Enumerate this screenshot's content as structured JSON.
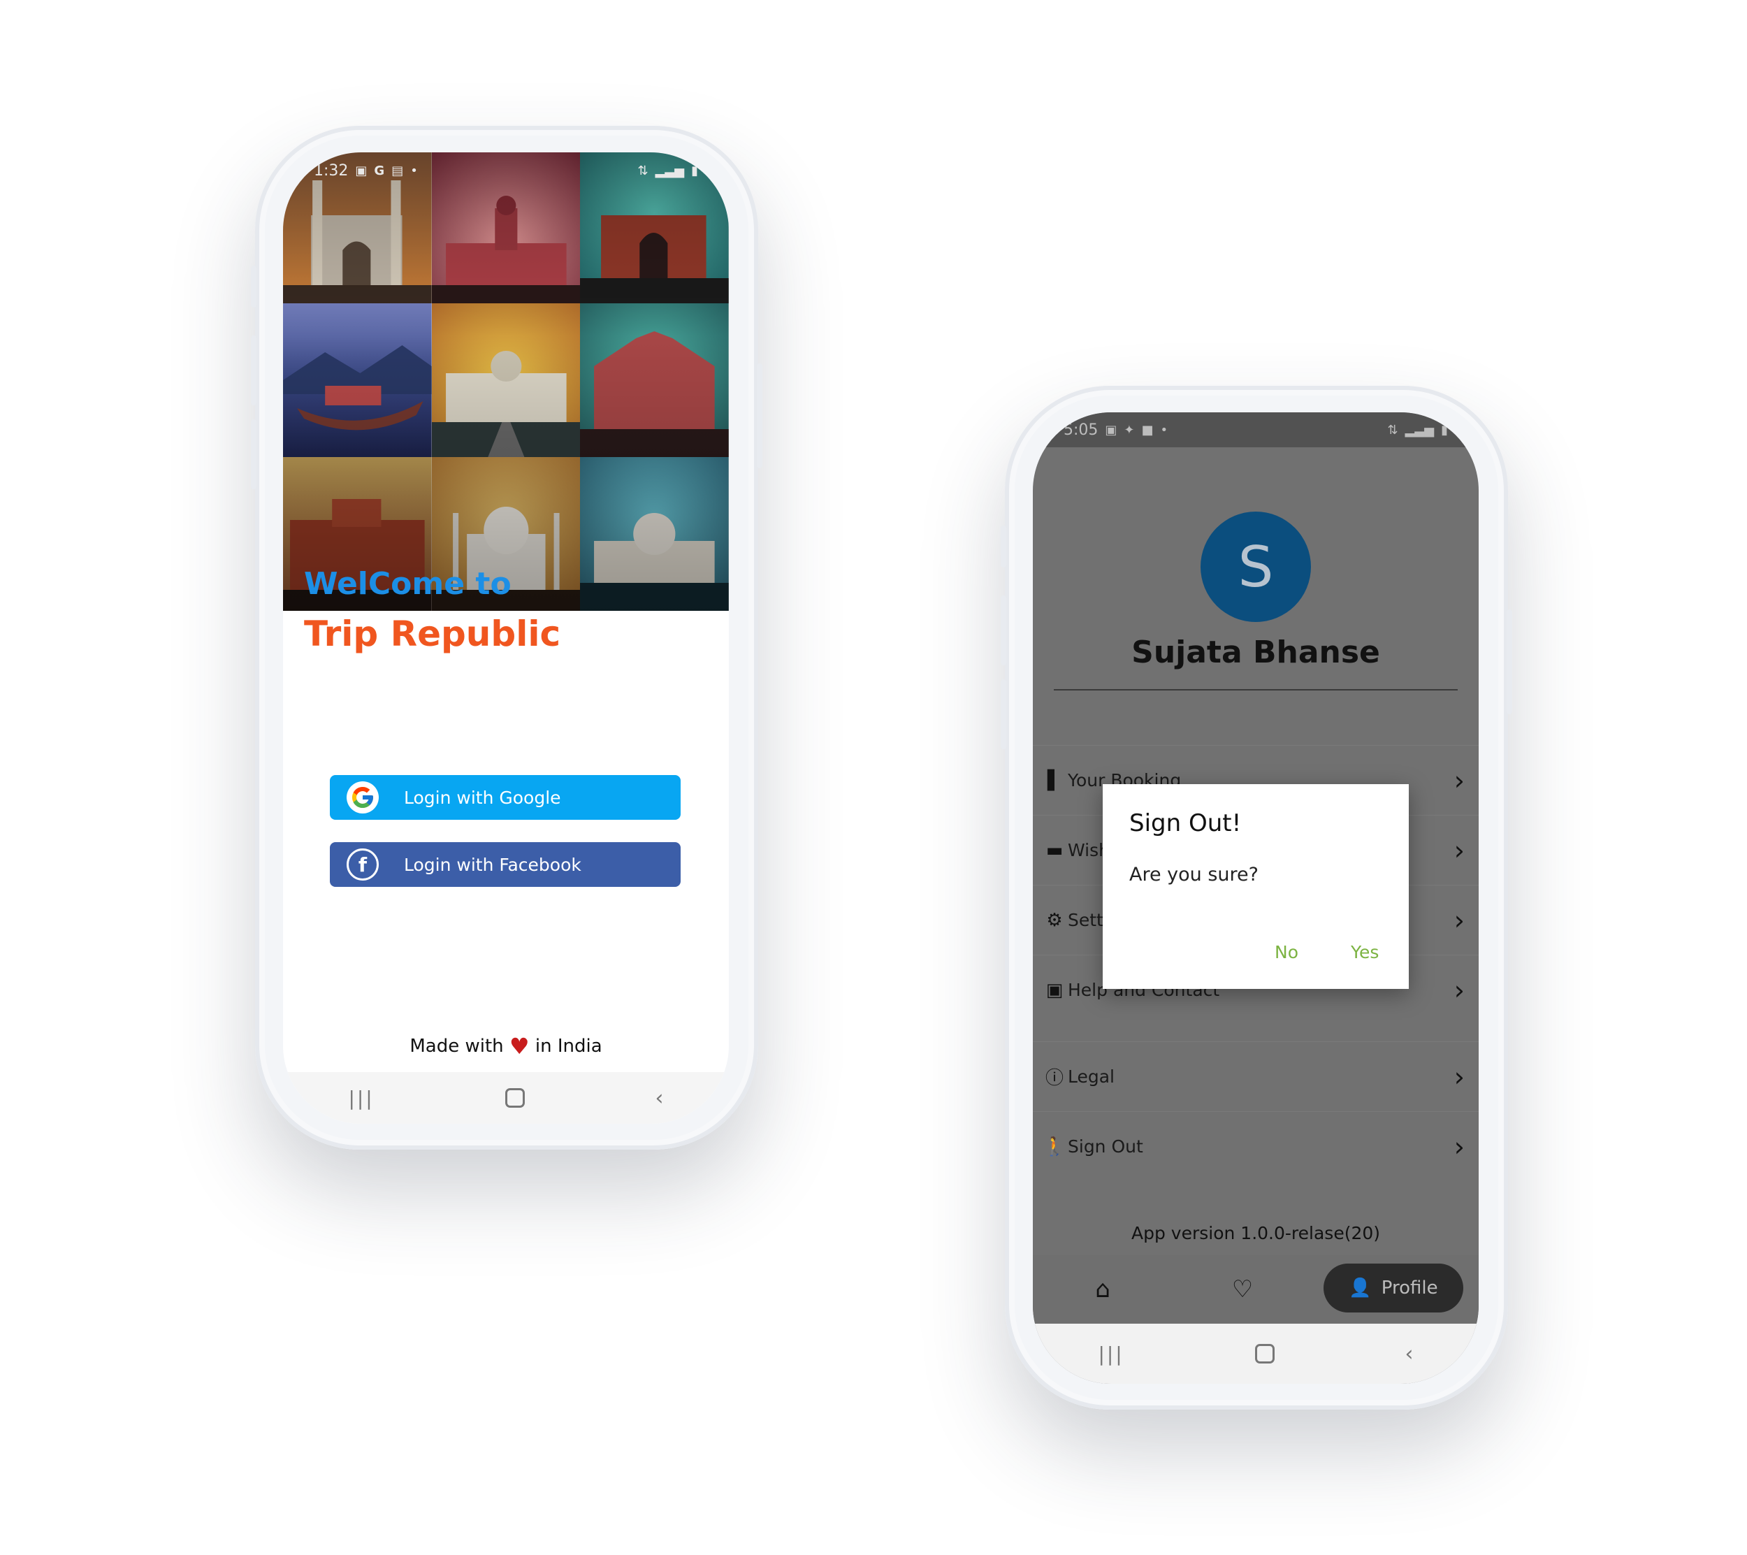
{
  "phone1": {
    "status": {
      "time": "1:32"
    },
    "welcome": "WelCome to",
    "brand": "Trip Republic",
    "google_button": "Login with Google",
    "facebook_button": "Login with Facebook",
    "footer": {
      "made_with": "Made with",
      "in_india": "in India"
    }
  },
  "phone2": {
    "status": {
      "time": "5:05"
    },
    "avatar_letter": "S",
    "user_name": "Sujata Bhanse",
    "menu": [
      {
        "label": "Your Booking",
        "icon": "book-icon"
      },
      {
        "label": "Wish",
        "icon": "wallet-icon"
      },
      {
        "label": "Sett",
        "icon": "gear-icon"
      },
      {
        "label": "Help and Contact",
        "icon": "contact-icon"
      },
      {
        "label": "Legal",
        "icon": "info-icon"
      },
      {
        "label": "Sign Out",
        "icon": "walk-icon"
      }
    ],
    "version": "App version 1.0.0-relase(20)",
    "tabs": {
      "profile": "Profile"
    },
    "dialog": {
      "title": "Sign Out!",
      "message": "Are you sure?",
      "no": "No",
      "yes": "Yes"
    }
  },
  "colors": {
    "google_blue": "#08a6f2",
    "facebook_blue": "#3c5ea8",
    "brand_orange": "#f0561f",
    "welcome_blue": "#1c8fe6",
    "avatar_blue": "#0b4e7e",
    "dialog_action_green": "#7cb342"
  }
}
